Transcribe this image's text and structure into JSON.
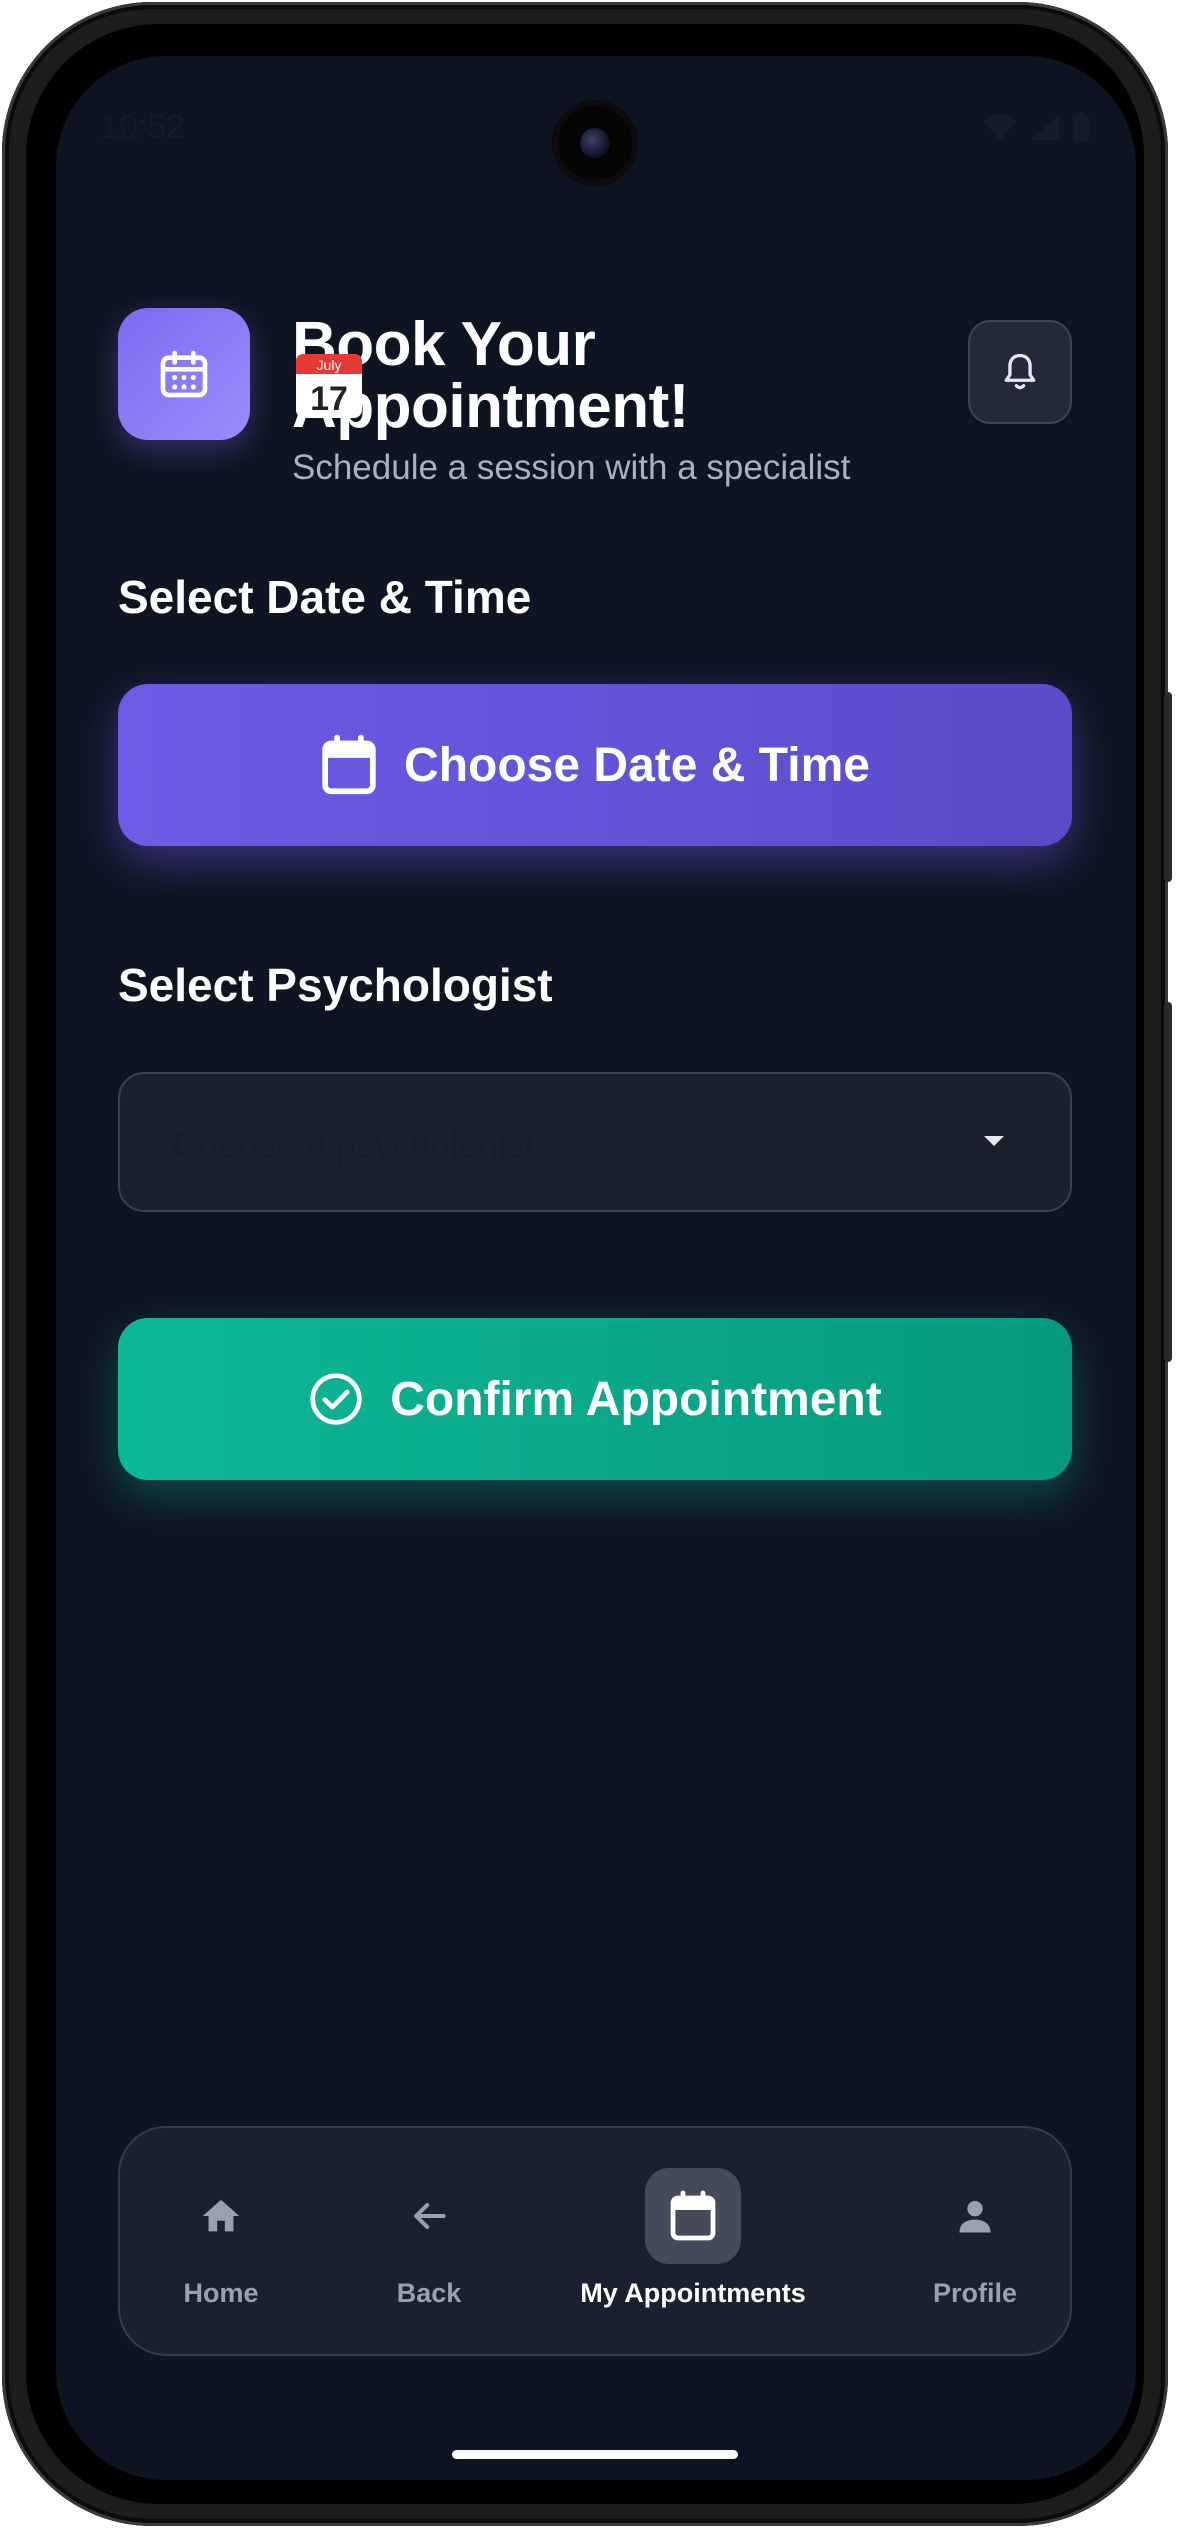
{
  "status_bar": {
    "time": "10:52"
  },
  "header": {
    "title": "Book Your Appointment!",
    "emoji_month": "July",
    "emoji_day": "17",
    "subtitle": "Schedule a session with a specialist"
  },
  "date_section": {
    "label": "Select Date & Time",
    "button_label": "Choose Date & Time"
  },
  "psychologist_section": {
    "label": "Select Psychologist",
    "placeholder": "Choose a psychologist"
  },
  "confirm_button": {
    "label": "Confirm Appointment"
  },
  "bottom_nav": {
    "items": [
      {
        "label": "Home",
        "icon": "home-icon"
      },
      {
        "label": "Back",
        "icon": "arrow-left-icon"
      },
      {
        "label": "My Appointments",
        "icon": "calendar-icon",
        "active": true
      },
      {
        "label": "Profile",
        "icon": "person-icon"
      }
    ]
  },
  "colors": {
    "background": "#0e1421",
    "primary": "#6c5ce7",
    "success": "#0db896",
    "card": "#1a202c"
  }
}
